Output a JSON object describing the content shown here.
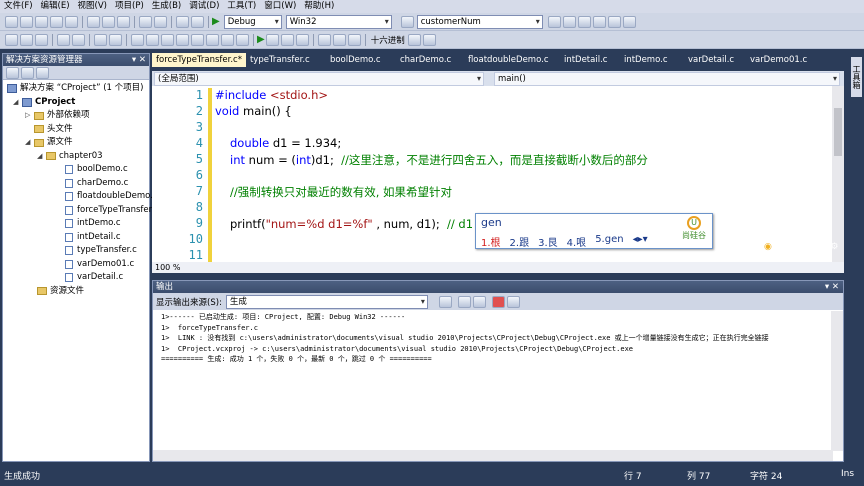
{
  "menu": [
    "文件(F)",
    "编辑(E)",
    "视图(V)",
    "项目(P)",
    "生成(B)",
    "调试(D)",
    "工具(T)",
    "窗口(W)",
    "帮助(H)"
  ],
  "toolbar": {
    "config": "Debug",
    "platform": "Win32",
    "find_value": "customerNum",
    "hex_label": "十六进制"
  },
  "solution": {
    "title": "解决方案资源管理器",
    "root": "解决方案 “CProject” (1 个项目)",
    "project": "CProject",
    "external": "外部依赖项",
    "headers": "头文件",
    "sources": "源文件",
    "folder": "chapter03",
    "files": [
      "boolDemo.c",
      "charDemo.c",
      "floatdoubleDemo.",
      "forceTypeTransfer",
      "intDemo.c",
      "intDetail.c",
      "typeTransfer.c",
      "varDemo01.c",
      "varDetail.c"
    ],
    "resources": "资源文件"
  },
  "tabs": [
    "forceTypeTransfer.c*",
    "typeTransfer.c",
    "boolDemo.c",
    "charDemo.c",
    "floatdoubleDemo.c",
    "intDetail.c",
    "intDemo.c",
    "varDetail.c",
    "varDemo01.c"
  ],
  "nav": {
    "scope": "(全局范围)",
    "member": "main()"
  },
  "code": {
    "line_numbers": [
      "1",
      "2",
      "3",
      "4",
      "5",
      "6",
      "7",
      "8",
      "9",
      "10",
      "11"
    ],
    "l1_kw": "#include ",
    "l1_str": "<stdio.h>",
    "l2_kw": "void",
    "l2_rest": " main() {",
    "l4_kw": "double",
    "l4_rest": " d1 = 1.934;",
    "l5_kw": "int",
    "l5_mid1": " num = (",
    "l5_kw2": "int",
    "l5_mid2": ")d1;  ",
    "l5_cmt": "//这里注意，不是进行四舍五入，而是直接截断小数后的部分",
    "l7_cmt": "//强制转换只对最近的数有效, 如果希望针对",
    "l9_fn": "printf(",
    "l9_str": "\"num=%d d1=%f\"",
    "l9_rest": " , num, d1);  ",
    "l9_cmt": "// d1 仍"
  },
  "zoom": "100 %",
  "ime": {
    "input": "gen",
    "candidates": [
      "1.根",
      "2.跟",
      "3.艮",
      "4.哏",
      "5.gen"
    ],
    "brand": "尚硅谷"
  },
  "ime_status": "中",
  "output": {
    "title": "输出",
    "source_label": "显示输出来源(S):",
    "source_value": "生成",
    "lines": [
      "1>------ 已启动生成: 项目: CProject, 配置: Debug Win32 ------",
      "1>  forceTypeTransfer.c",
      "1>  LINK : 没有找到 c:\\users\\administrator\\documents\\visual studio 2010\\Projects\\CProject\\Debug\\CProject.exe 或上一个增量链接没有生成它；正在执行完全链接",
      "1>  CProject.vcxproj -> c:\\users\\administrator\\documents\\visual studio 2010\\Projects\\CProject\\Debug\\CProject.exe",
      "========== 生成: 成功 1 个，失败 0 个，最新 0 个，跳过 0 个 =========="
    ]
  },
  "toolbox_label": "工具箱",
  "status": {
    "message": "生成成功",
    "row": "行 7",
    "col": "列 77",
    "char": "字符 24",
    "mode": "Ins"
  }
}
